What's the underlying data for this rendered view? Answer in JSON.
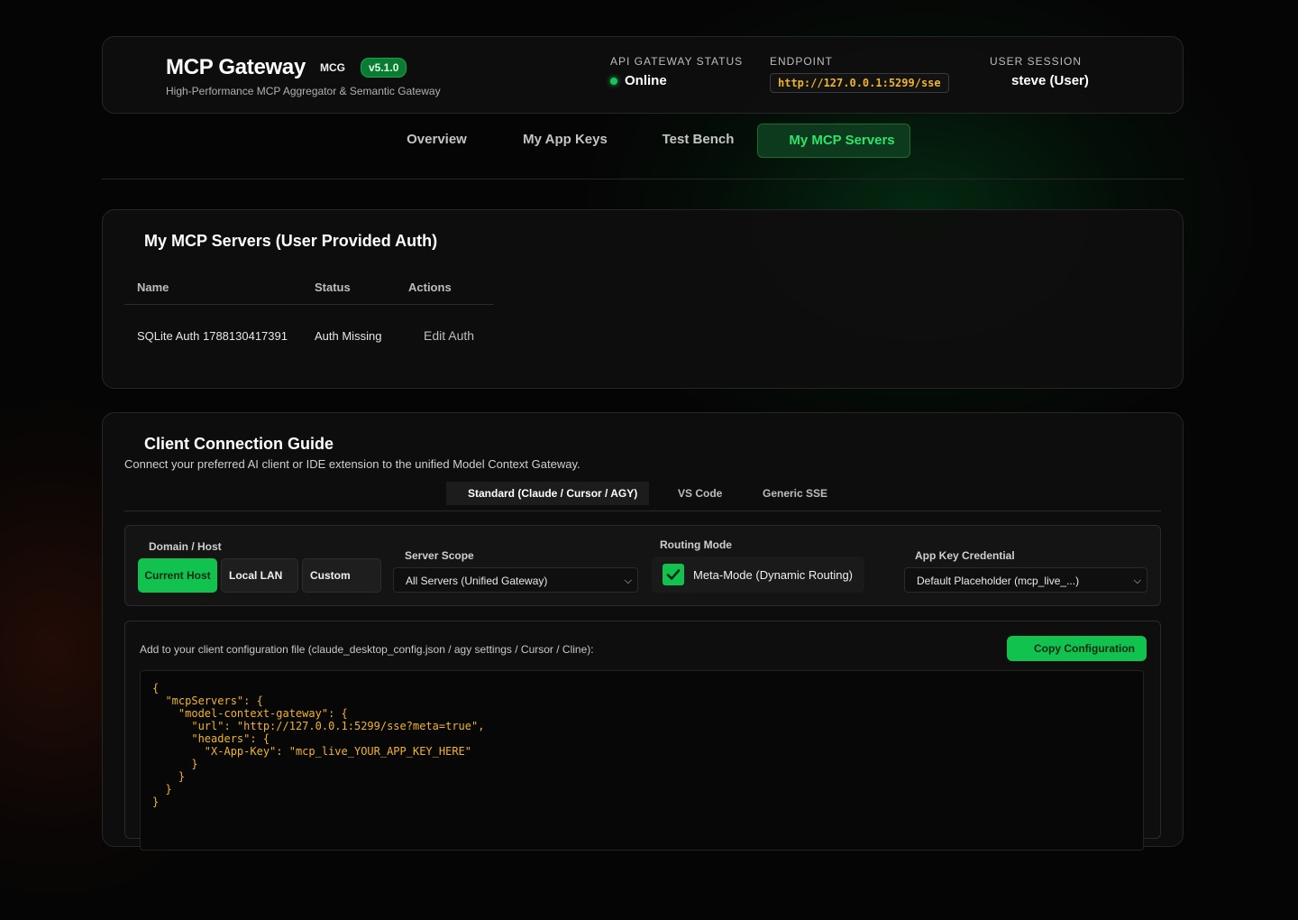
{
  "header": {
    "title": "MCP Gateway",
    "abbr": "MCG",
    "version": "v5.1.0",
    "subtitle": "High-Performance MCP Aggregator & Semantic Gateway",
    "status_label": "API Gateway Status",
    "status_value": "Online",
    "endpoint_label": "Endpoint",
    "endpoint_value": "http://127.0.0.1:5299/sse",
    "session_label": "User Session",
    "session_value": "steve (User)"
  },
  "nav": {
    "tabs": [
      {
        "label": "Overview"
      },
      {
        "label": "My App Keys"
      },
      {
        "label": "Test Bench"
      },
      {
        "label": "My MCP Servers"
      }
    ],
    "active": "My MCP Servers"
  },
  "servers": {
    "title": "My MCP Servers (User Provided Auth)",
    "columns": [
      "Name",
      "Status",
      "Actions"
    ],
    "rows": [
      {
        "name": "SQLite Auth 1788130417391",
        "status": "Auth Missing",
        "action": "Edit Auth"
      }
    ]
  },
  "guide": {
    "title": "Client Connection Guide",
    "description": "Connect your preferred AI client or IDE extension to the unified Model Context Gateway.",
    "tabs": [
      {
        "label": "Standard (Claude / Cursor / AGY)"
      },
      {
        "label": "VS Code"
      },
      {
        "label": "Generic SSE"
      }
    ],
    "domain_label": "Domain / Host",
    "domain_options": [
      "Current Host",
      "Local LAN",
      "Custom"
    ],
    "domain_selected": "Current Host",
    "scope_label": "Server Scope",
    "scope_value": "All Servers (Unified Gateway)",
    "routing_label": "Routing Mode",
    "routing_option": "Meta-Mode (Dynamic Routing)",
    "routing_checked": true,
    "appkey_label": "App Key Credential",
    "appkey_value": "Default Placeholder (mcp_live_...)",
    "config_hint": "Add to your client configuration file (claude_desktop_config.json / agy settings / Cursor / Cline):",
    "copy_label": "Copy Configuration",
    "config_code": "{\n  \"mcpServers\": {\n    \"model-context-gateway\": {\n      \"url\": \"http://127.0.0.1:5299/sse?meta=true\",\n      \"headers\": {\n        \"X-App-Key\": \"mcp_live_YOUR_APP_KEY_HERE\"\n      }\n    }\n  }\n}"
  },
  "colors": {
    "accent": "#11c24f",
    "code_text": "#f0b429",
    "background": "#050505"
  }
}
